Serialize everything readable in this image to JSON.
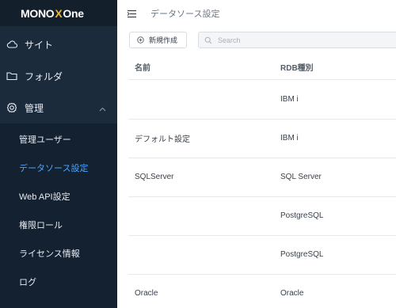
{
  "app": {
    "logo_left": "MONO",
    "logo_x": "X",
    "logo_right": "One"
  },
  "sidebar": {
    "site_label": "サイト",
    "folder_label": "フォルダ",
    "admin_label": "管理",
    "sub_items": [
      {
        "label": "管理ユーザー"
      },
      {
        "label": "データソース設定"
      },
      {
        "label": "Web API設定"
      },
      {
        "label": "権限ロール"
      },
      {
        "label": "ライセンス情報"
      },
      {
        "label": "ログ"
      }
    ]
  },
  "header": {
    "title": "データソース設定"
  },
  "toolbar": {
    "new_label": "新規作成",
    "search_placeholder": "Search"
  },
  "table": {
    "columns": [
      "名前",
      "RDB種別"
    ],
    "rows": [
      {
        "name": "",
        "type": "IBM i"
      },
      {
        "name": "デフォルト設定",
        "type": "IBM i"
      },
      {
        "name": "SQLServer",
        "type": "SQL Server"
      },
      {
        "name": "",
        "type": "PostgreSQL"
      },
      {
        "name": "",
        "type": "PostgreSQL"
      },
      {
        "name": "Oracle",
        "type": "Oracle"
      }
    ]
  },
  "colors": {
    "sidebar_bg": "#1c2b3c",
    "submenu_bg": "#142130",
    "active_item": "#4aa3ff",
    "logo_accent": "#f2b632"
  }
}
